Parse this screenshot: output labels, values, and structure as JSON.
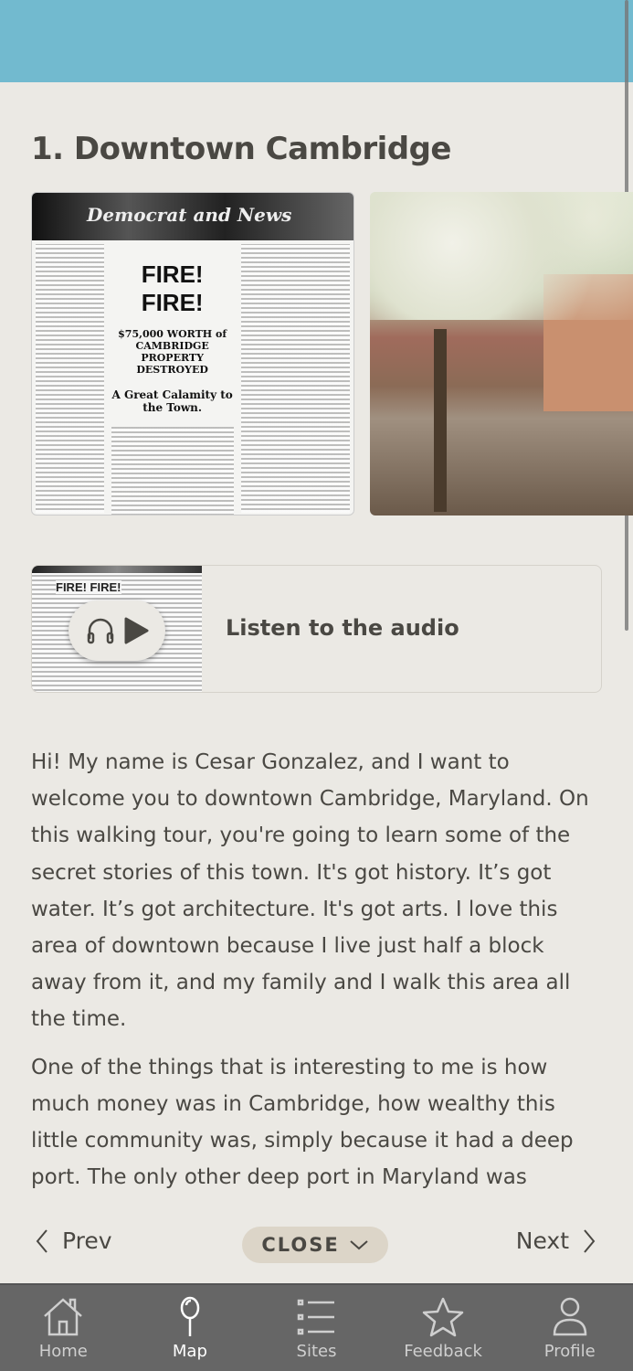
{
  "page_title": "1. Downtown Cambridge",
  "newspaper": {
    "masthead": "Democrat and News",
    "headline": "FIRE! FIRE!",
    "subhead": "$75,000 WORTH of CAMBRIDGE PROPERTY DESTROYED",
    "deck": "A Great Calamity to the Town."
  },
  "audio": {
    "label": "Listen to the audio",
    "thumb_text": "FIRE! FIRE!"
  },
  "body": [
    "Hi! My name is Cesar Gonzalez, and I want to welcome you to downtown Cambridge, Maryland. On this walking tour, you're going to learn some of the secret stories of this town. It's got history. It’s got water. It’s got architecture. It's got arts. I love this area of downtown because I live just half a block away from it, and my family and I walk this area all the time.",
    "One of the things that is interesting to me is how much money was in Cambridge, how wealthy this little community was, simply because it had a deep port. The only other deep port in Maryland was"
  ],
  "nav": {
    "prev": "Prev",
    "close": "CLOSE",
    "next": "Next"
  },
  "tabs": [
    {
      "label": "Home"
    },
    {
      "label": "Map"
    },
    {
      "label": "Sites"
    },
    {
      "label": "Feedback"
    },
    {
      "label": "Profile"
    }
  ],
  "colors": {
    "header": "#72bacf",
    "background": "#ebe9e4",
    "tabbar": "#666666",
    "close_pill": "#dcd5c8"
  }
}
